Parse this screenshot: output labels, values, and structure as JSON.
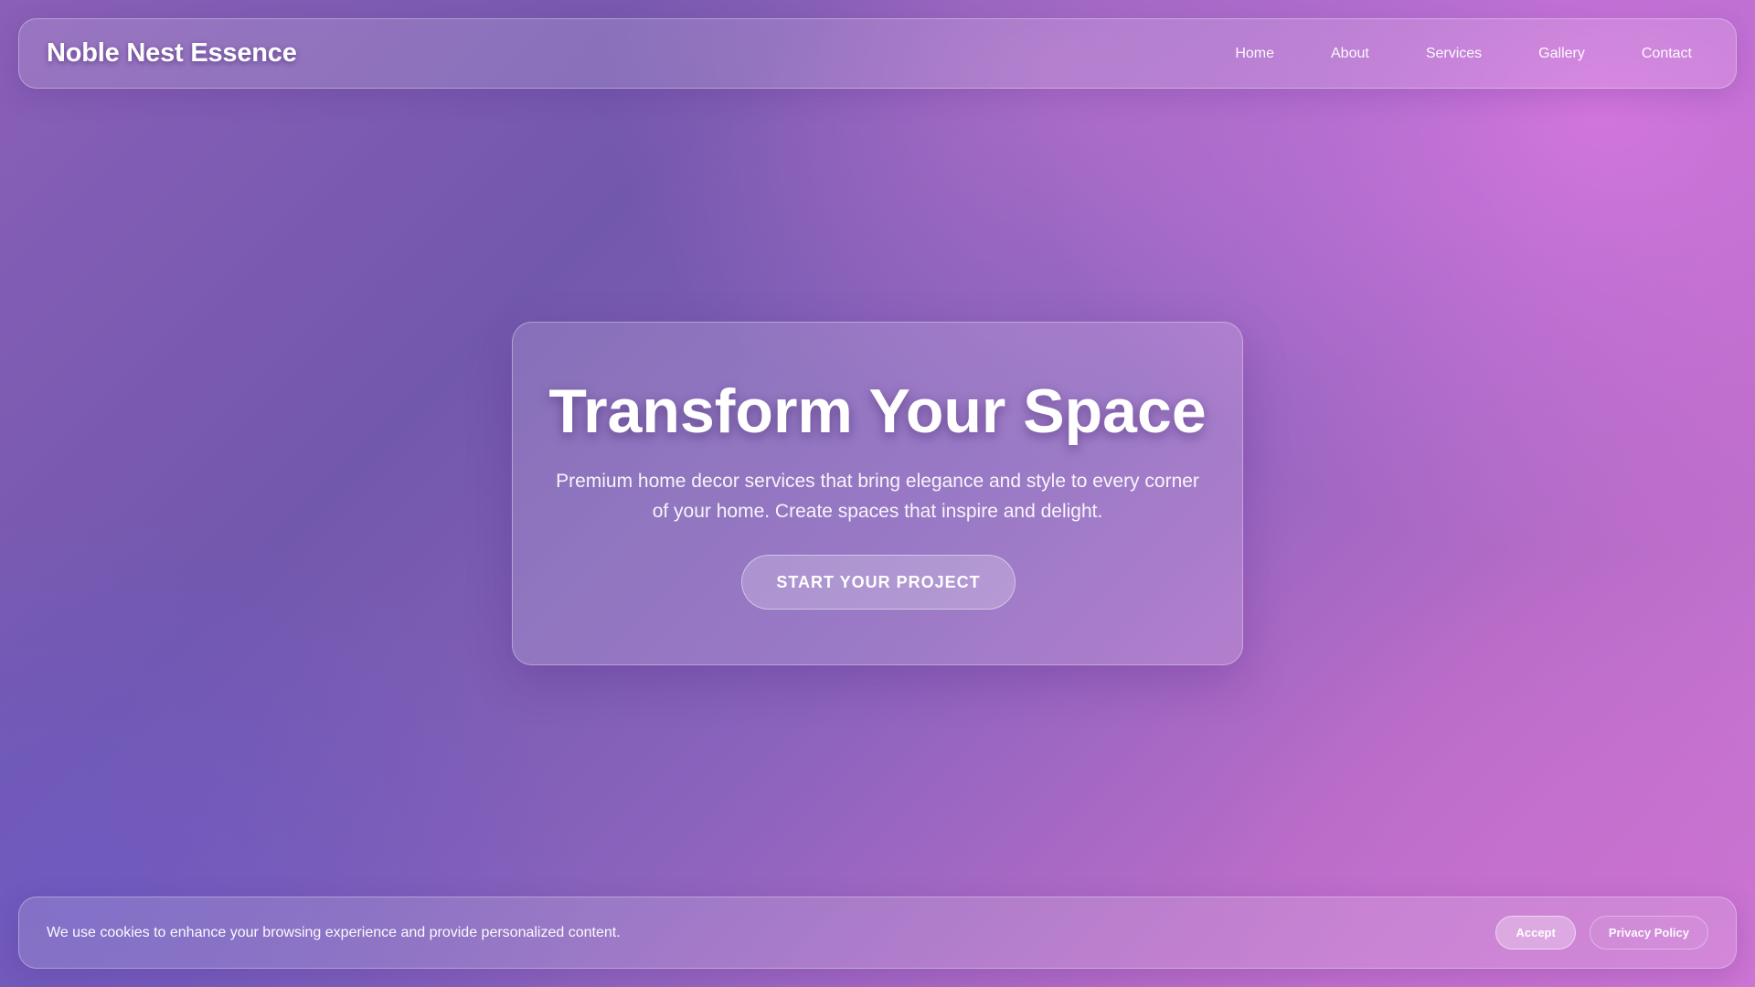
{
  "header": {
    "brand": "Noble Nest Essence",
    "nav": [
      "Home",
      "About",
      "Services",
      "Gallery",
      "Contact"
    ]
  },
  "hero": {
    "title": "Transform Your Space",
    "subtitle": "Premium home decor services that bring elegance and style to every corner of your home. Create spaces that inspire and delight.",
    "cta_label": "START YOUR PROJECT"
  },
  "cookie_banner": {
    "message": "We use cookies to enhance your browsing experience and provide personalized content.",
    "accept_label": "Accept",
    "privacy_label": "Privacy Policy"
  },
  "colors": {
    "gradient_start": "#7258ad",
    "gradient_end": "#cf79d8",
    "text": "#ffffff"
  }
}
